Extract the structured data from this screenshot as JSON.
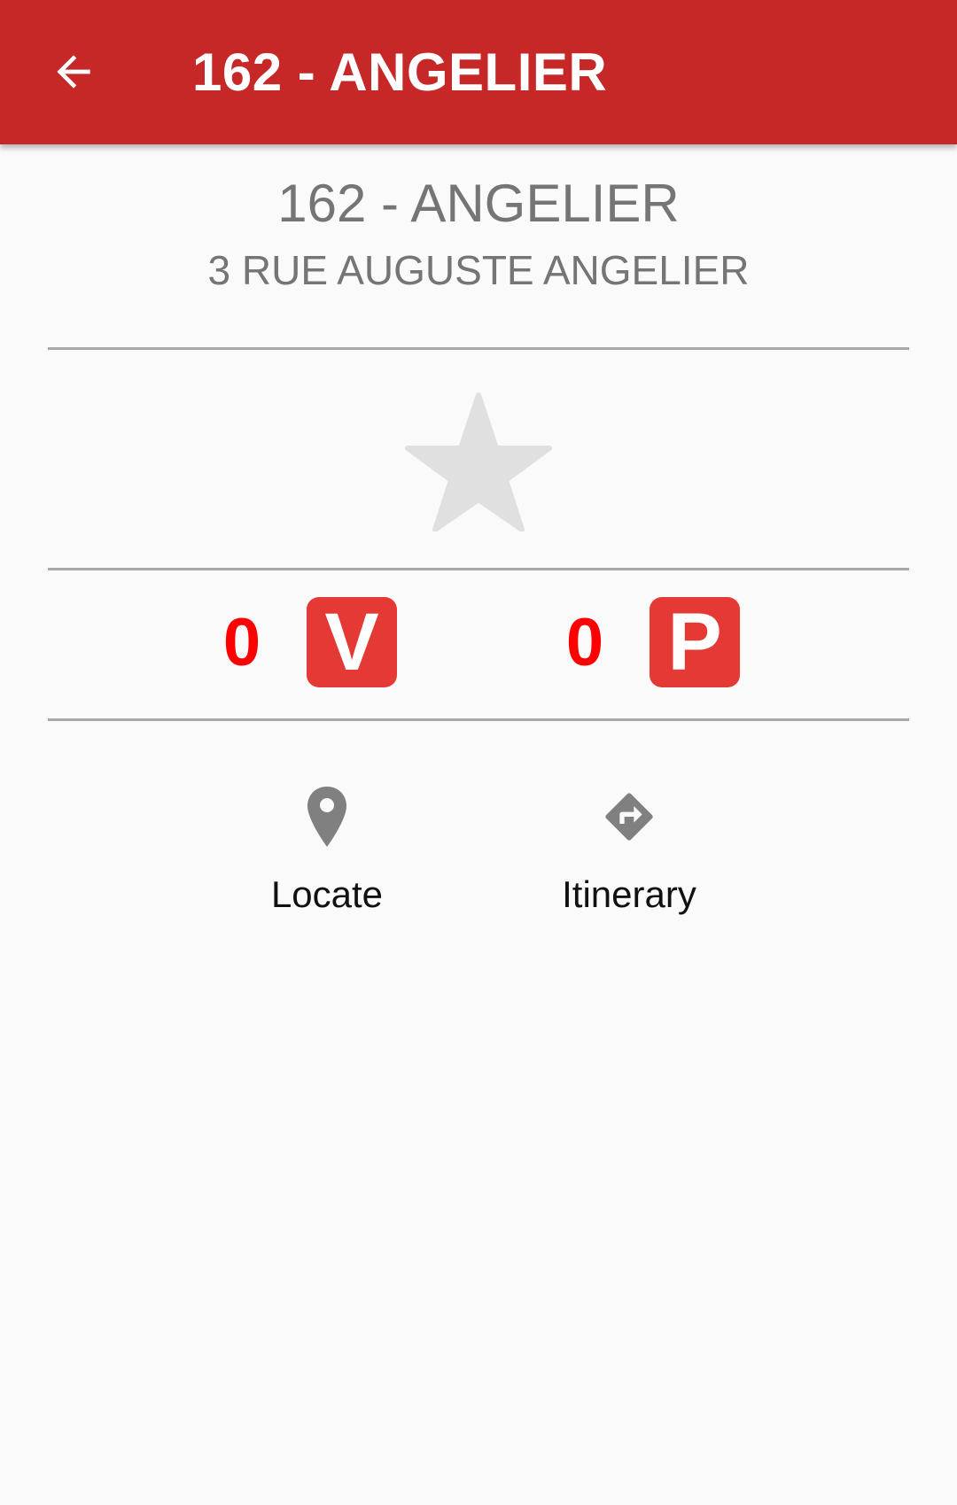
{
  "appbar": {
    "title": "162 - ANGELIER",
    "back_icon": "arrow-back-icon",
    "background_color": "#c62828"
  },
  "station": {
    "name": "162 - ANGELIER",
    "address": "3 RUE AUGUSTE ANGELIER"
  },
  "favorite": {
    "icon": "star-icon",
    "state": "not-favorite",
    "color": "#e0e0e0"
  },
  "availability": {
    "bikes": {
      "count": "0",
      "badge": "V"
    },
    "parking": {
      "count": "0",
      "badge": "P"
    },
    "count_color": "#ff0000",
    "badge_color": "#e53935"
  },
  "actions": {
    "locate": {
      "label": "Locate",
      "icon": "map-pin-icon"
    },
    "itinerary": {
      "label": "Itinerary",
      "icon": "directions-icon"
    },
    "icon_color": "#808080"
  }
}
